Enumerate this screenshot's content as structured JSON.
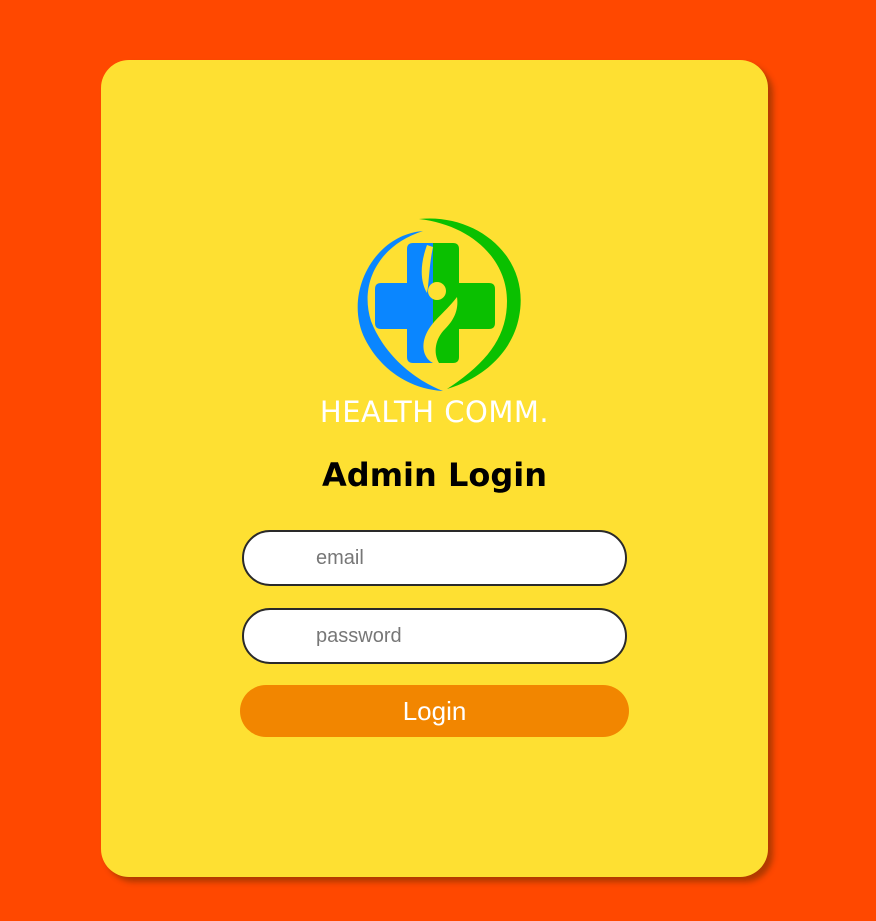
{
  "colors": {
    "background": "#ff4800",
    "card": "#fee032",
    "button": "#f28600",
    "logo_blue": "#0a86ff",
    "logo_green": "#0ac000"
  },
  "brand": {
    "logo_icon": "medical-cross-person-icon",
    "name": "HEALTH COMM."
  },
  "form": {
    "title": "Admin Login",
    "email_placeholder": "email",
    "password_placeholder": "password",
    "submit_label": "Login"
  }
}
